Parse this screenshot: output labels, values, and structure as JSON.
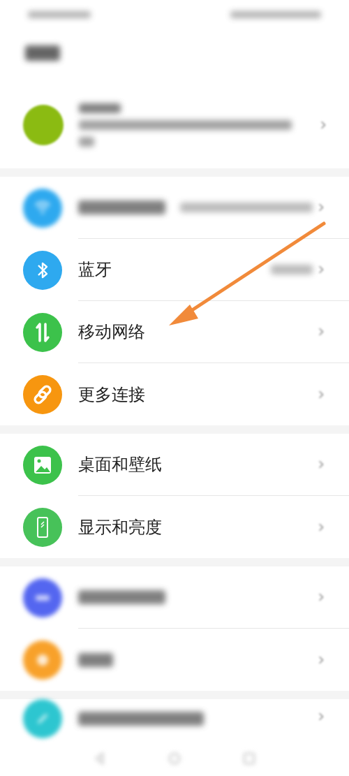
{
  "account": {
    "kind": "account",
    "color": "#8bbb12"
  },
  "sections": [
    {
      "items": [
        {
          "kind": "wifi",
          "color": "#2ea9ef",
          "blurred": true,
          "value_blurred": true
        },
        {
          "kind": "bluetooth",
          "color": "#2ea9ef",
          "label": "蓝牙",
          "blurred": false,
          "value_blurred": true
        },
        {
          "kind": "mobile",
          "color": "#3cc24b",
          "label": "移动网络",
          "blurred": false,
          "value_blurred": false
        },
        {
          "kind": "link",
          "color": "#f7960f",
          "label": "更多连接",
          "blurred": false,
          "value_blurred": false
        }
      ]
    },
    {
      "items": [
        {
          "kind": "wallpaper",
          "color": "#3cc24b",
          "label": "桌面和壁纸",
          "blurred": false,
          "value_blurred": false
        },
        {
          "kind": "display",
          "color": "#47c259",
          "label": "显示和亮度",
          "blurred": false,
          "value_blurred": false
        }
      ]
    },
    {
      "items": [
        {
          "kind": "sound",
          "color": "#5466f0",
          "blurred": true,
          "value_blurred": false
        },
        {
          "kind": "notify",
          "color": "#f8a12a",
          "blurred": true,
          "value_blurred": false
        }
      ]
    },
    {
      "items": [
        {
          "kind": "bio",
          "color": "#2dc6d0",
          "blurred": true,
          "value_blurred": false
        }
      ]
    }
  ]
}
